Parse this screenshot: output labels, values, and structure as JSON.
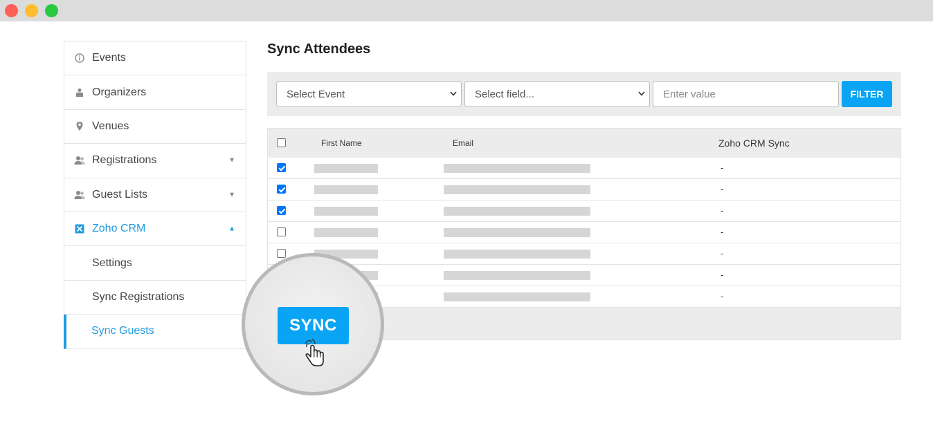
{
  "window": {
    "controls": [
      "close",
      "minimize",
      "maximize"
    ]
  },
  "sidebar": {
    "items": [
      {
        "label": "Events",
        "icon": "info-circle-icon"
      },
      {
        "label": "Organizers",
        "icon": "person-icon"
      },
      {
        "label": "Venues",
        "icon": "map-pin-icon"
      },
      {
        "label": "Registrations",
        "icon": "users-icon",
        "caret": "▼"
      },
      {
        "label": "Guest Lists",
        "icon": "users-icon",
        "caret": "▼"
      },
      {
        "label": "Zoho CRM",
        "icon": "zoho-icon",
        "caret": "▲",
        "active": true
      }
    ],
    "subitems": [
      {
        "label": "Settings"
      },
      {
        "label": "Sync Registrations"
      },
      {
        "label": "Sync Guests",
        "current": true
      }
    ]
  },
  "main": {
    "title": "Sync Attendees",
    "filter": {
      "event_select": "Select Event",
      "field_select": "Select field...",
      "value_placeholder": "Enter value",
      "button": "FILTER"
    },
    "table": {
      "headers": {
        "first_name": "First Name",
        "email": "Email",
        "sync": "Zoho CRM Sync"
      },
      "rows": [
        {
          "checked": true,
          "sync": "-"
        },
        {
          "checked": true,
          "sync": "-"
        },
        {
          "checked": true,
          "sync": "-"
        },
        {
          "checked": false,
          "sync": "-"
        },
        {
          "checked": false,
          "sync": "-"
        },
        {
          "checked": false,
          "sync": "-"
        },
        {
          "checked": false,
          "sync": "-"
        }
      ]
    },
    "sync_button": "SYNC"
  },
  "colors": {
    "accent": "#0aa4f5",
    "active_text": "#1e9be0"
  }
}
